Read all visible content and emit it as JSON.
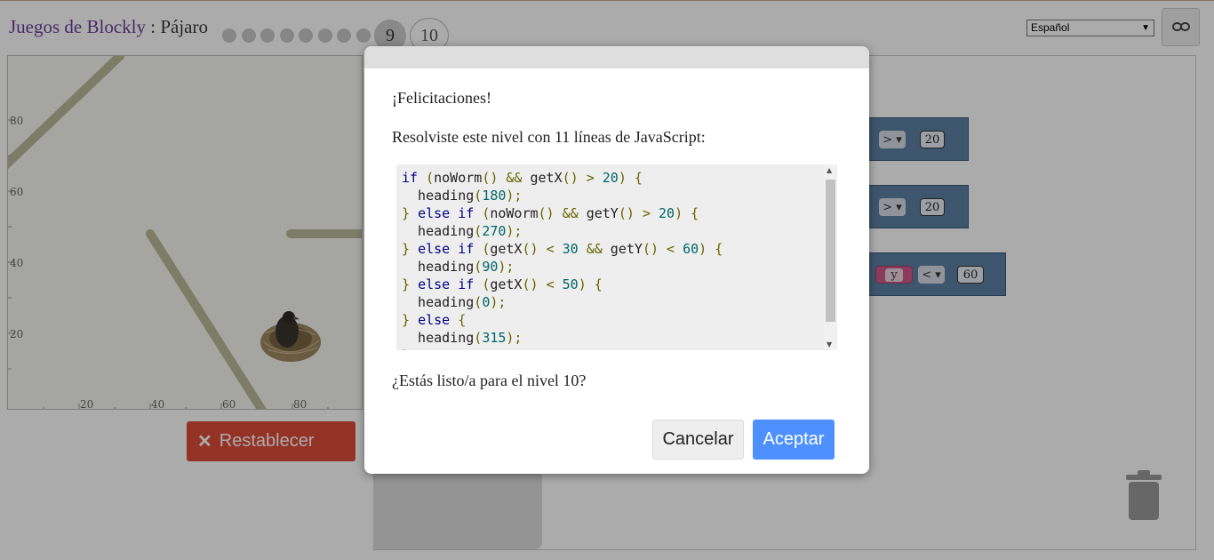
{
  "header": {
    "games_link": "Juegos de Blockly",
    "separator": " : ",
    "game_name": "Pájaro",
    "current_level": "9",
    "next_level": "10",
    "language": "Español"
  },
  "viz": {
    "y_ticks": [
      "80",
      "60",
      "40",
      "20"
    ],
    "x_ticks": [
      "20",
      "40",
      "60",
      "80"
    ]
  },
  "reset_label": "Restablecer",
  "blocks": {
    "op1": "> ▾",
    "val1": "20",
    "op2": "> ▾",
    "val2": "20",
    "var3": "y",
    "op3": "< ▾",
    "val3": "60"
  },
  "dialog": {
    "congrats": "¡Felicitaciones!",
    "solved": "Resolviste este nivel con 11 líneas de JavaScript:",
    "ready": "¿Estás listo/a para el nivel 10?",
    "cancel_label": "Cancelar",
    "ok_label": "Aceptar"
  },
  "colors": {
    "reset": "#dd4b39",
    "accept": "#4d90fe",
    "block": "#5b80a5"
  }
}
